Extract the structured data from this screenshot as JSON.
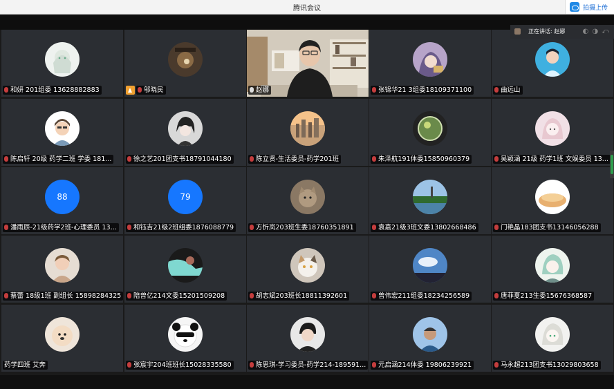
{
  "window": {
    "title": "腾讯会议",
    "cloud_button": "拍摄上传"
  },
  "speaking": {
    "text": "正在讲话: 赵娜"
  },
  "tiles": [
    {
      "label": "和妍 201组委 13628882883",
      "mic": "muted",
      "avatar": "anime-girl"
    },
    {
      "label": "邬晓民",
      "mic": "muted",
      "avatar": "dark-photo",
      "host": true
    },
    {
      "label": "赵娜",
      "mic": "on",
      "avatar": "video"
    },
    {
      "label": "张锦华21 3组委18109371100",
      "mic": "muted",
      "avatar": "anime-purple"
    },
    {
      "label": "曲远山",
      "mic": "muted",
      "avatar": "anime-blue"
    },
    {
      "label": "陈启轩 20级 药学二班 学委 181...",
      "mic": "muted",
      "avatar": "cartoon-boy"
    },
    {
      "label": "徐之艺201团支书18791044180",
      "mic": "muted",
      "avatar": "anime-dark"
    },
    {
      "label": "陈立贤-生活委员-药学201班",
      "mic": "muted",
      "avatar": "city"
    },
    {
      "label": "朱泽航191体委15850960379",
      "mic": "muted",
      "avatar": "globe"
    },
    {
      "label": "吴颖涵 21级 药学1班 文娱委员 13...",
      "mic": "muted",
      "avatar": "anime-pink"
    },
    {
      "label": "潘雨辰-21级药学2班-心理委员 13...",
      "mic": "muted",
      "avatar": "num",
      "num": "88"
    },
    {
      "label": "和钰吉21级2班组委1876088779",
      "mic": "muted",
      "avatar": "num",
      "num": "79"
    },
    {
      "label": "方忻岚203班生委18760351891",
      "mic": "muted",
      "avatar": "cat-brown"
    },
    {
      "label": "袁嘉21级3班文委13802668486",
      "mic": "muted",
      "avatar": "lake"
    },
    {
      "label": "门艳晶183团支书13146056288",
      "mic": "muted",
      "avatar": "bread"
    },
    {
      "label": "蔡蕾 18级1班 副组长 15898284325",
      "mic": "muted",
      "avatar": "baby"
    },
    {
      "label": "陪曾亿214文委15201509208",
      "mic": "muted",
      "avatar": "art-cyan"
    },
    {
      "label": "胡志斌203班长18811392601",
      "mic": "muted",
      "avatar": "cat-white"
    },
    {
      "label": "曾伟宏211组委18234256589",
      "mic": "muted",
      "avatar": "sky"
    },
    {
      "label": "唐菲夏213生委15676368587",
      "mic": "muted",
      "avatar": "anime-teal"
    },
    {
      "label": "药学四班 艾奔",
      "mic": "none",
      "avatar": "dog"
    },
    {
      "label": "张宸宇204班班长15028335580",
      "mic": "muted",
      "avatar": "panda"
    },
    {
      "label": "陈思琪-学习委员-药学214-189591...",
      "mic": "muted",
      "avatar": "boy-photo"
    },
    {
      "label": "元启涵214体委 19806239921",
      "mic": "muted",
      "avatar": "person-blue"
    },
    {
      "label": "马永超213团支书13029803658",
      "mic": "muted",
      "avatar": "anime-white"
    }
  ]
}
